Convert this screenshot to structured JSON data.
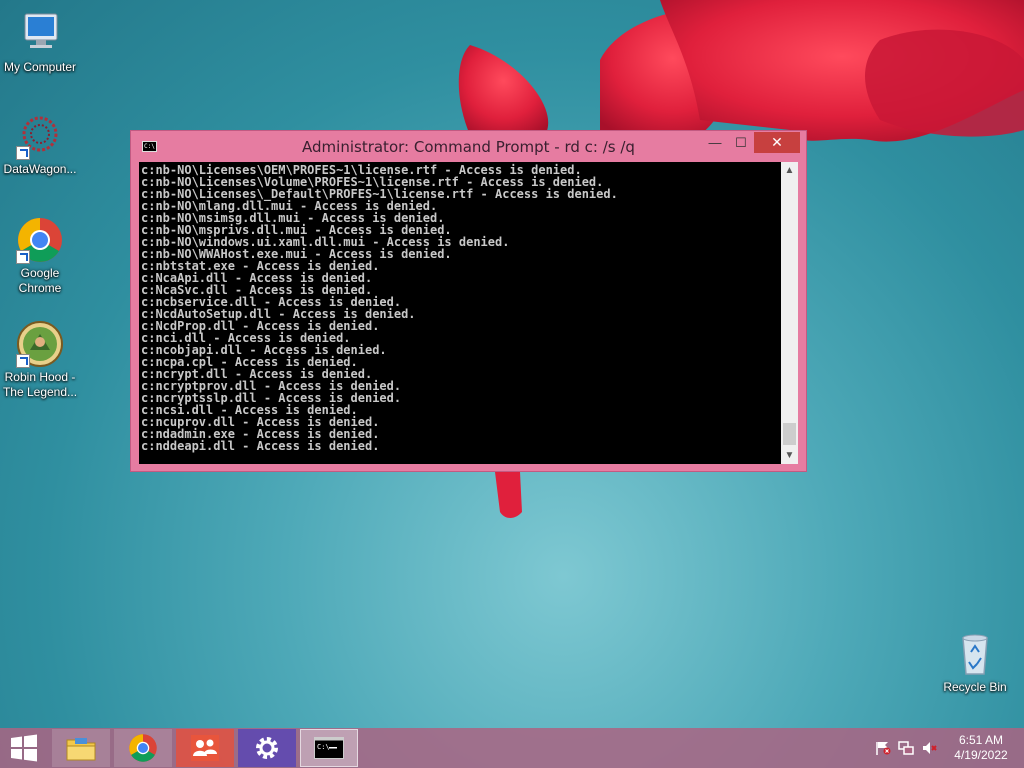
{
  "desktop": {
    "icons": [
      {
        "label": "My Computer",
        "icon": "computer-icon"
      },
      {
        "label": "DataWagon...",
        "icon": "datawagon-icon"
      },
      {
        "label": "Google Chrome",
        "icon": "chrome-icon"
      },
      {
        "label": "Robin Hood - The Legend...",
        "icon": "robin-hood-icon"
      },
      {
        "label": "Recycle Bin",
        "icon": "recycle-bin-icon"
      }
    ]
  },
  "window": {
    "title": "Administrator: Command Prompt - rd  c: /s /q",
    "controls": {
      "minimize": "—",
      "maximize": "☐",
      "close": "✕"
    },
    "lines": [
      "c:nb-NO\\Licenses\\OEM\\PROFES~1\\license.rtf - Access is denied.",
      "c:nb-NO\\Licenses\\Volume\\PROFES~1\\license.rtf - Access is denied.",
      "c:nb-NO\\Licenses\\_Default\\PROFES~1\\license.rtf - Access is denied.",
      "c:nb-NO\\mlang.dll.mui - Access is denied.",
      "c:nb-NO\\msimsg.dll.mui - Access is denied.",
      "c:nb-NO\\msprivs.dll.mui - Access is denied.",
      "c:nb-NO\\windows.ui.xaml.dll.mui - Access is denied.",
      "c:nb-NO\\WWAHost.exe.mui - Access is denied.",
      "c:nbtstat.exe - Access is denied.",
      "c:NcaApi.dll - Access is denied.",
      "c:NcaSvc.dll - Access is denied.",
      "c:ncbservice.dll - Access is denied.",
      "c:NcdAutoSetup.dll - Access is denied.",
      "c:NcdProp.dll - Access is denied.",
      "c:nci.dll - Access is denied.",
      "c:ncobjapi.dll - Access is denied.",
      "c:ncpa.cpl - Access is denied.",
      "c:ncrypt.dll - Access is denied.",
      "c:ncryptprov.dll - Access is denied.",
      "c:ncryptsslp.dll - Access is denied.",
      "c:ncsi.dll - Access is denied.",
      "c:ncuprov.dll - Access is denied.",
      "c:ndadmin.exe - Access is denied.",
      "c:nddeapi.dll - Access is denied."
    ]
  },
  "taskbar": {
    "items": [
      {
        "name": "file-explorer",
        "icon": "folder-icon"
      },
      {
        "name": "chrome",
        "icon": "chrome-icon"
      },
      {
        "name": "users",
        "icon": "users-icon"
      },
      {
        "name": "settings",
        "icon": "gear-icon"
      },
      {
        "name": "command-prompt",
        "icon": "cmd-icon",
        "active": true
      }
    ],
    "clock": {
      "time": "6:51 AM",
      "date": "4/19/2022"
    }
  },
  "colors": {
    "window_frame": "#e67ca1",
    "close_button": "#c7403f",
    "console_bg": "#000000",
    "console_text": "#c8c8c8"
  }
}
